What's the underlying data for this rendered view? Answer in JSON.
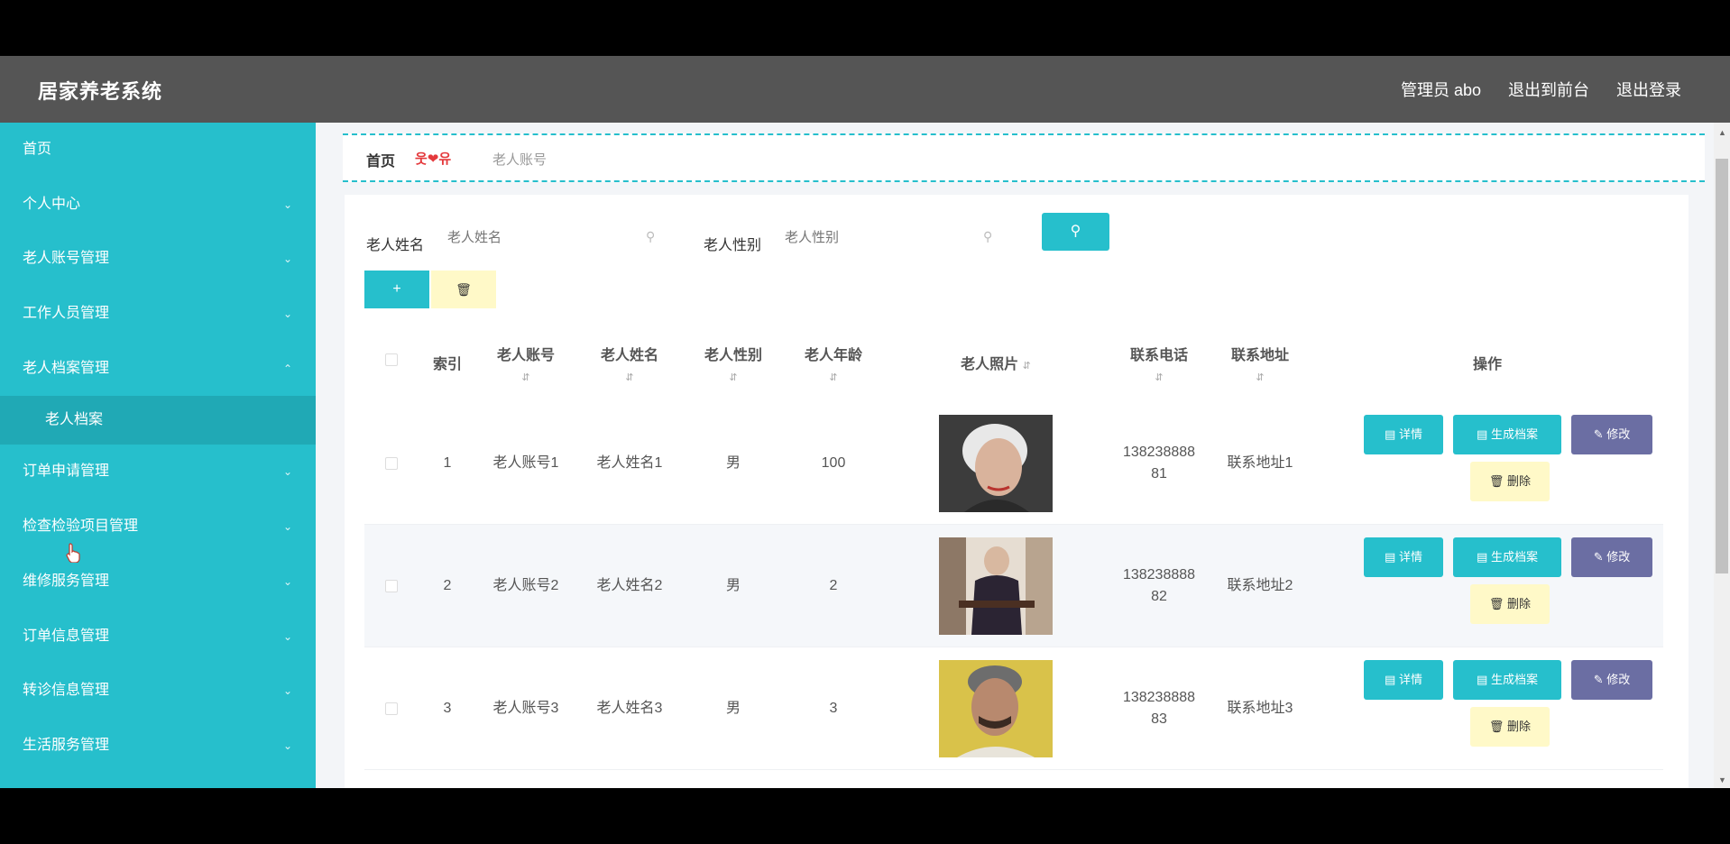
{
  "header": {
    "title": "居家养老系统",
    "links": [
      "管理员 abo",
      "退出到前台",
      "退出登录"
    ]
  },
  "sidebar": {
    "items": [
      {
        "label": "首页",
        "expandable": false
      },
      {
        "label": "个人中心",
        "expandable": true
      },
      {
        "label": "老人账号管理",
        "expandable": true
      },
      {
        "label": "工作人员管理",
        "expandable": true
      },
      {
        "label": "老人档案管理",
        "expandable": true,
        "expanded": true
      },
      {
        "label": "老人档案",
        "sub": true,
        "active": true
      },
      {
        "label": "订单申请管理",
        "expandable": true
      },
      {
        "label": "检查检验项目管理",
        "expandable": true
      },
      {
        "label": "维修服务管理",
        "expandable": true
      },
      {
        "label": "订单信息管理",
        "expandable": true
      },
      {
        "label": "转诊信息管理",
        "expandable": true
      },
      {
        "label": "生活服务管理",
        "expandable": true
      }
    ]
  },
  "breadcrumb": {
    "home": "首页",
    "separator": "웃❤유",
    "current": "老人账号"
  },
  "search": {
    "name_label": "老人姓名",
    "name_placeholder": "老人姓名",
    "gender_label": "老人性别",
    "gender_placeholder": "老人性别"
  },
  "toolbar": {
    "add_icon": "plus-icon",
    "delete_icon": "trash-icon"
  },
  "table": {
    "headers": [
      "索引",
      "老人账号",
      "老人姓名",
      "老人性别",
      "老人年龄",
      "老人照片",
      "联系电话",
      "联系地址",
      "操作"
    ],
    "rows": [
      {
        "index": "1",
        "account": "老人账号1",
        "name": "老人姓名1",
        "gender": "男",
        "age": "100",
        "phone": "13823888881",
        "address": "联系地址1"
      },
      {
        "index": "2",
        "account": "老人账号2",
        "name": "老人姓名2",
        "gender": "男",
        "age": "2",
        "phone": "13823888882",
        "address": "联系地址2"
      },
      {
        "index": "3",
        "account": "老人账号3",
        "name": "老人姓名3",
        "gender": "男",
        "age": "3",
        "phone": "13823888883",
        "address": "联系地址3"
      }
    ],
    "actions": {
      "detail": "详情",
      "generate": "生成档案",
      "edit": "修改",
      "remove": "删除"
    }
  },
  "colors": {
    "accent": "#26bfcc",
    "header_bg": "#555555",
    "edit_btn": "#6b6ea3",
    "delete_btn": "#fff9c8"
  }
}
